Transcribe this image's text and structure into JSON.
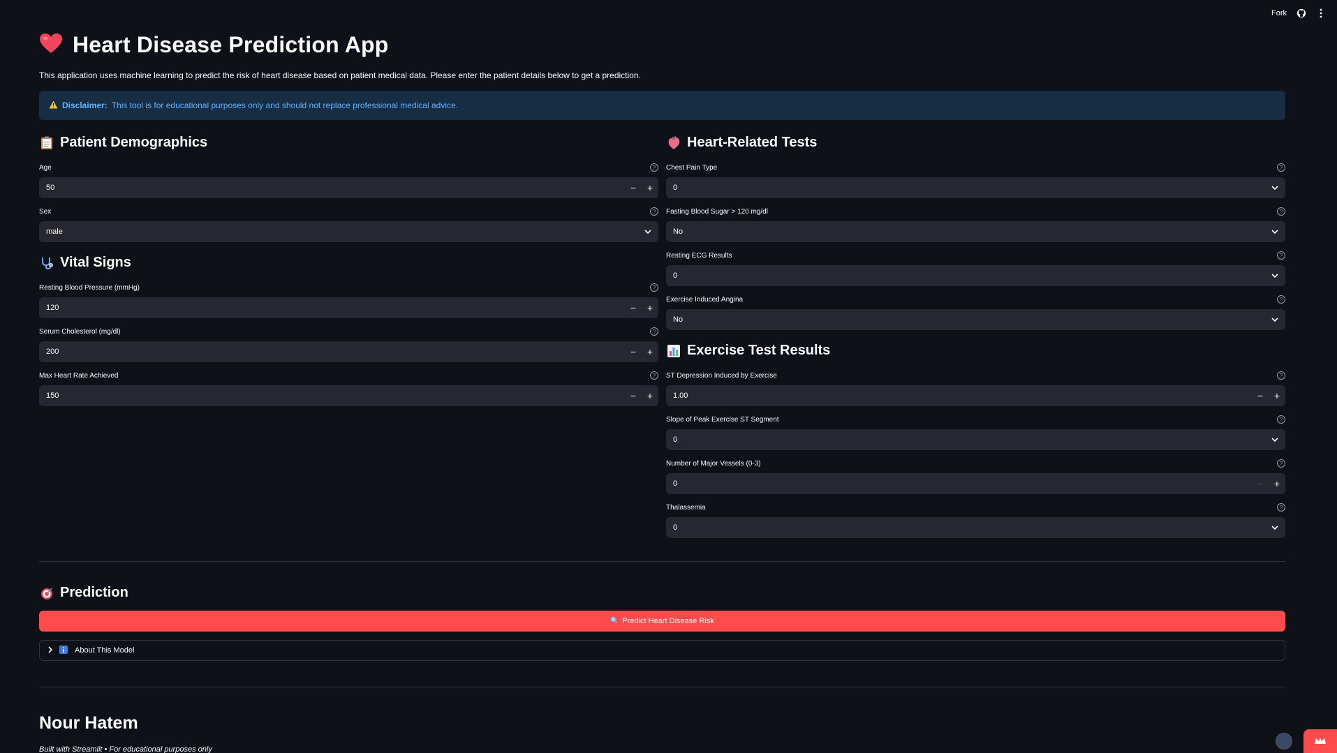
{
  "toolbar": {
    "fork_label": "Fork",
    "github_icon": "github-icon",
    "menu_icon": "kebab-menu-icon"
  },
  "app": {
    "title": "Heart Disease Prediction App",
    "title_icon": "heart-icon",
    "intro": "This application uses machine learning to predict the risk of heart disease based on patient medical data. Please enter the patient details below to get a prediction.",
    "disclaimer_label": "Disclaimer:",
    "disclaimer_text": "This tool is for educational purposes only and should not replace professional medical advice."
  },
  "sections": {
    "demographics": "Patient Demographics",
    "vitals": "Vital Signs",
    "heart_tests": "Heart-Related Tests",
    "exercise": "Exercise Test Results",
    "prediction": "Prediction"
  },
  "fields": {
    "age": {
      "label": "Age",
      "value": "50"
    },
    "sex": {
      "label": "Sex",
      "value": "male"
    },
    "bp": {
      "label": "Resting Blood Pressure (mmHg)",
      "value": "120"
    },
    "chol": {
      "label": "Serum Cholesterol (mg/dl)",
      "value": "200"
    },
    "maxhr": {
      "label": "Max Heart Rate Achieved",
      "value": "150"
    },
    "cp": {
      "label": "Chest Pain Type",
      "value": "0"
    },
    "fbs": {
      "label": "Fasting Blood Sugar > 120 mg/dl",
      "value": "No"
    },
    "ecg": {
      "label": "Resting ECG Results",
      "value": "0"
    },
    "angina": {
      "label": "Exercise Induced Angina",
      "value": "No"
    },
    "st": {
      "label": "ST Depression Induced by Exercise",
      "value": "1.00"
    },
    "slope": {
      "label": "Slope of Peak Exercise ST Segment",
      "value": "0"
    },
    "vessels": {
      "label": "Number of Major Vessels (0-3)",
      "value": "0"
    },
    "thal": {
      "label": "Thalassemia",
      "value": "0"
    }
  },
  "predict_button": "Predict Heart Disease Risk",
  "expander_label": "About This Model",
  "author": "Nour Hatem",
  "footer": "Built with Streamlit • For educational purposes only",
  "colors": {
    "background": "#0e1117",
    "input": "#262730",
    "accent": "#ff4b4b",
    "info_bg": "#172d43",
    "info_text": "#60b4ff"
  }
}
